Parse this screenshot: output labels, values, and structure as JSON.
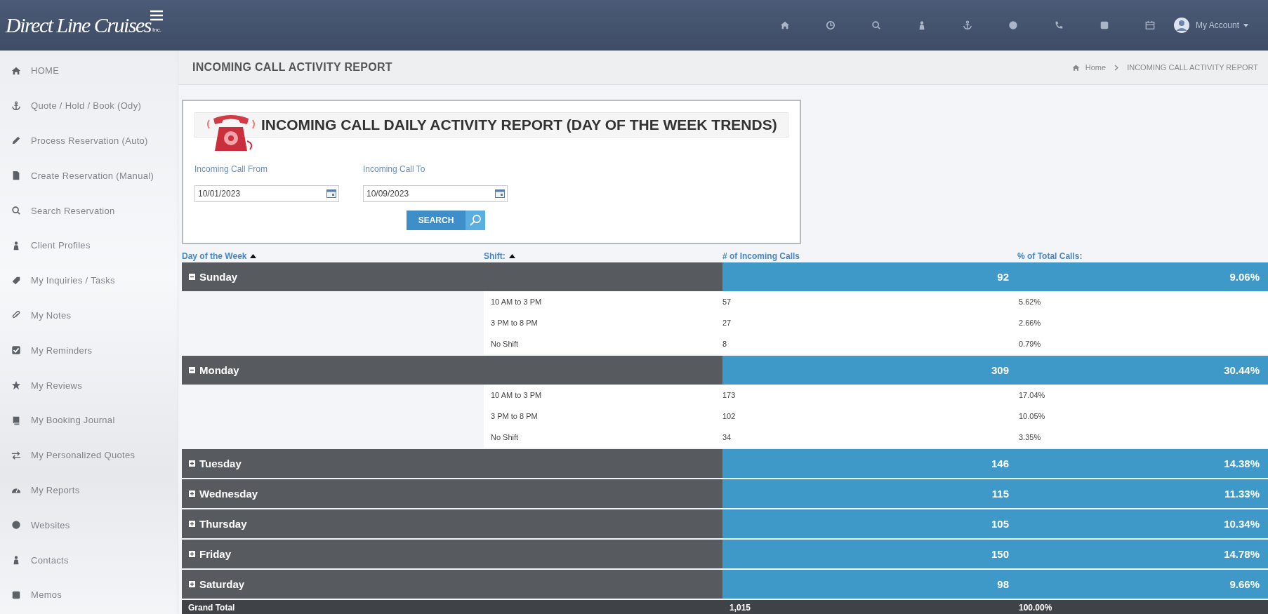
{
  "logo": {
    "name": "Direct Line Cruises",
    "suffix": "Inc."
  },
  "top_bar": {
    "account": "My Account"
  },
  "sidebar": {
    "items": [
      {
        "label": "HOME"
      },
      {
        "label": "Quote / Hold / Book (Ody)"
      },
      {
        "label": "Process Reservation (Auto)"
      },
      {
        "label": "Create Reservation (Manual)"
      },
      {
        "label": "Search Reservation"
      },
      {
        "label": "Client Profiles"
      },
      {
        "label": "My Inquiries / Tasks"
      },
      {
        "label": "My Notes"
      },
      {
        "label": "My Reminders"
      },
      {
        "label": "My Reviews"
      },
      {
        "label": "My Booking Journal"
      },
      {
        "label": "My Personalized Quotes"
      },
      {
        "label": "My Reports"
      },
      {
        "label": "Websites"
      },
      {
        "label": "Contacts"
      },
      {
        "label": "Memos"
      }
    ]
  },
  "page_header": {
    "title": "INCOMING CALL ACTIVITY REPORT",
    "breadcrumb": [
      "Home",
      "INCOMING CALL ACTIVITY REPORT"
    ]
  },
  "report_card": {
    "title": "INCOMING CALL DAILY ACTIVITY REPORT (DAY OF THE WEEK TRENDS)",
    "from": {
      "label": "Incoming Call From",
      "value": "10/01/2023"
    },
    "to": {
      "label": "Incoming Call To",
      "value": "10/09/2023"
    },
    "search_button": "SEARCH"
  },
  "table": {
    "columns": [
      {
        "label": "Day of the Week",
        "sorted": true
      },
      {
        "label": "Shift:",
        "sorted": true
      },
      {
        "label": "# of Incoming Calls",
        "sorted": false
      },
      {
        "label": "% of Total Calls:",
        "sorted": false
      }
    ],
    "groups": [
      {
        "day": "Sunday",
        "expanded": true,
        "calls": "92",
        "percent": "9.06%",
        "shifts": [
          {
            "shift": "10 AM to 3 PM",
            "calls": "57",
            "percent": "5.62%"
          },
          {
            "shift": "3 PM to 8 PM",
            "calls": "27",
            "percent": "2.66%"
          },
          {
            "shift": "No Shift",
            "calls": "8",
            "percent": "0.79%"
          }
        ]
      },
      {
        "day": "Monday",
        "expanded": true,
        "calls": "309",
        "percent": "30.44%",
        "shifts": [
          {
            "shift": "10 AM to 3 PM",
            "calls": "173",
            "percent": "17.04%"
          },
          {
            "shift": "3 PM to 8 PM",
            "calls": "102",
            "percent": "10.05%"
          },
          {
            "shift": "No Shift",
            "calls": "34",
            "percent": "3.35%"
          }
        ]
      },
      {
        "day": "Tuesday",
        "expanded": false,
        "calls": "146",
        "percent": "14.38%"
      },
      {
        "day": "Wednesday",
        "expanded": false,
        "calls": "115",
        "percent": "11.33%"
      },
      {
        "day": "Thursday",
        "expanded": false,
        "calls": "105",
        "percent": "10.34%"
      },
      {
        "day": "Friday",
        "expanded": false,
        "calls": "150",
        "percent": "14.78%"
      },
      {
        "day": "Saturday",
        "expanded": false,
        "calls": "98",
        "percent": "9.66%"
      }
    ],
    "grand_total": {
      "label": "Grand Total",
      "calls": "1,015",
      "percent": "100.00%"
    }
  }
}
